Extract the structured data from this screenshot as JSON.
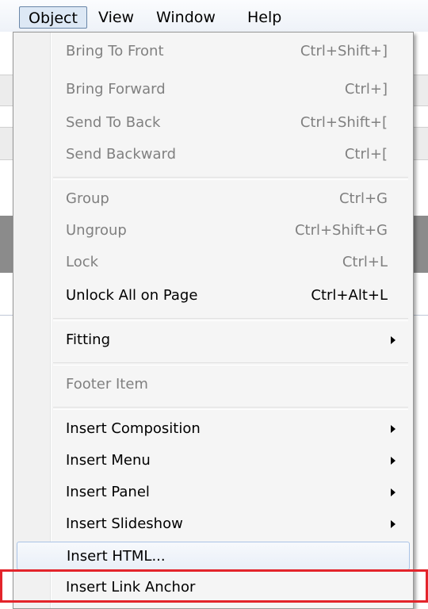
{
  "menubar": {
    "items": [
      "Object",
      "View",
      "Window",
      "Help"
    ]
  },
  "menu": {
    "items": [
      {
        "label": "Bring To Front",
        "shortcut": "Ctrl+Shift+]",
        "enabled": false
      },
      {
        "label": "Bring Forward",
        "shortcut": "Ctrl+]",
        "enabled": false
      },
      {
        "label": "Send To Back",
        "shortcut": "Ctrl+Shift+[",
        "enabled": false
      },
      {
        "label": "Send Backward",
        "shortcut": "Ctrl+[",
        "enabled": false
      },
      {
        "label": "Group",
        "shortcut": "Ctrl+G",
        "enabled": false
      },
      {
        "label": "Ungroup",
        "shortcut": "Ctrl+Shift+G",
        "enabled": false
      },
      {
        "label": "Lock",
        "shortcut": "Ctrl+L",
        "enabled": false
      },
      {
        "label": "Unlock All on Page",
        "shortcut": "Ctrl+Alt+L",
        "enabled": true
      },
      {
        "label": "Fitting",
        "shortcut": "",
        "enabled": true,
        "submenu": true
      },
      {
        "label": "Footer Item",
        "shortcut": "",
        "enabled": false
      },
      {
        "label": "Insert Composition",
        "shortcut": "",
        "enabled": true,
        "submenu": true
      },
      {
        "label": "Insert Menu",
        "shortcut": "",
        "enabled": true,
        "submenu": true
      },
      {
        "label": "Insert Panel",
        "shortcut": "",
        "enabled": true,
        "submenu": true
      },
      {
        "label": "Insert Slideshow",
        "shortcut": "",
        "enabled": true,
        "submenu": true
      },
      {
        "label": "Insert HTML...",
        "shortcut": "",
        "enabled": true
      },
      {
        "label": "Insert Link Anchor",
        "shortcut": "",
        "enabled": true
      }
    ]
  },
  "colors": {
    "highlight_box": "#e3242b",
    "disabled_text": "#808080",
    "hover_border": "#aac3e6"
  }
}
